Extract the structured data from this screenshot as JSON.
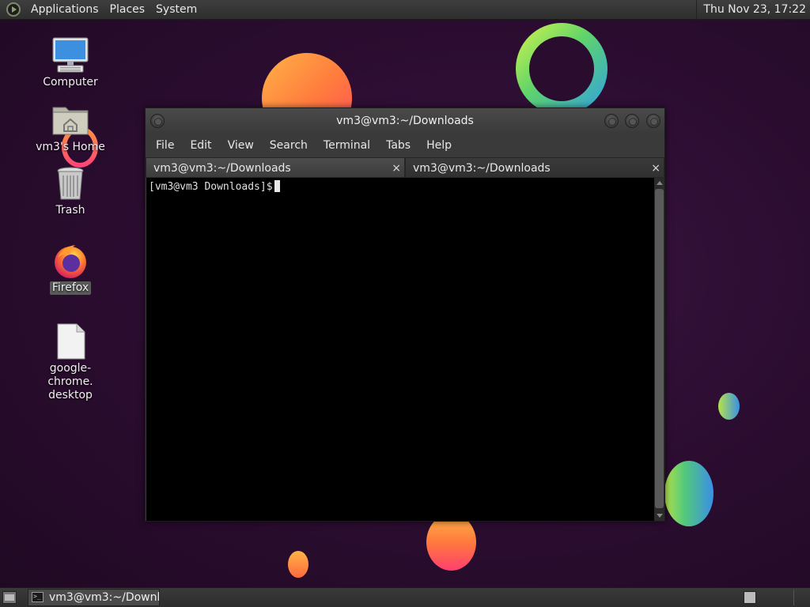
{
  "top_panel": {
    "menus": [
      "Applications",
      "Places",
      "System"
    ],
    "clock": "Thu Nov 23, 17:22"
  },
  "desktop": {
    "icons": [
      {
        "label": "Computer",
        "icon": "computer-icon"
      },
      {
        "label": "vm3's Home",
        "icon": "home-folder-icon"
      },
      {
        "label": "Trash",
        "icon": "trash-icon"
      },
      {
        "label": "Firefox",
        "icon": "firefox-icon"
      },
      {
        "label": "google-chrome.\ndesktop",
        "icon": "file-icon"
      }
    ]
  },
  "window": {
    "title": "vm3@vm3:~/Downloads",
    "menu": [
      "File",
      "Edit",
      "View",
      "Search",
      "Terminal",
      "Tabs",
      "Help"
    ],
    "tabs": [
      {
        "label": "vm3@vm3:~/Downloads",
        "close": "×"
      },
      {
        "label": "vm3@vm3:~/Downloads",
        "close": "×"
      }
    ],
    "prompt": "[vm3@vm3 Downloads]$"
  },
  "bottom_panel": {
    "task_label": "vm3@vm3:~/Downl..."
  },
  "colors": {
    "wallpaper": "#2a0c2f",
    "panel": "#333333",
    "terminal_bg": "#000000"
  }
}
